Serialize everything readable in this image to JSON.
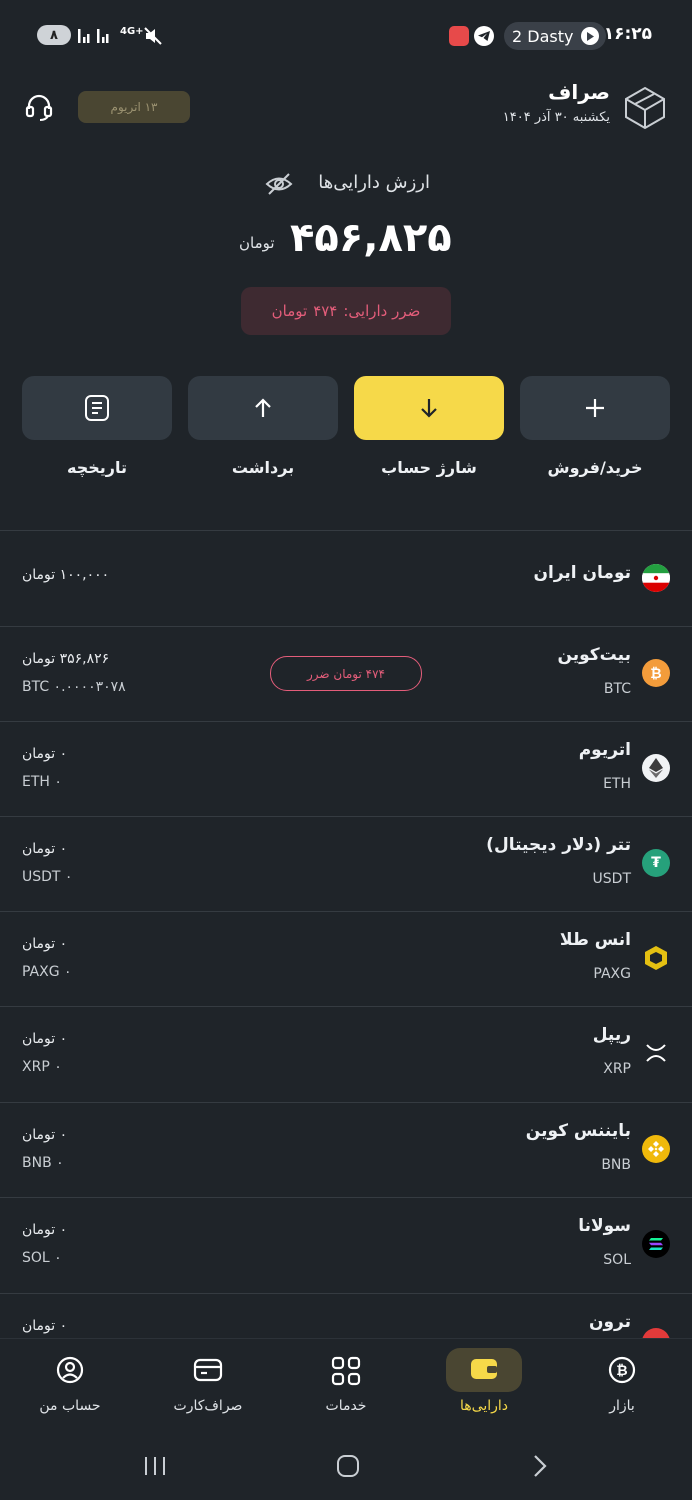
{
  "status_bar": {
    "time": "۱۶:۲۵",
    "media_chip": "2 Dasty",
    "battery": "۸",
    "network": "4G+"
  },
  "header": {
    "app_name": "صراف",
    "date": "یکشنبه ۳۰ آذر ۱۴۰۴",
    "chip": "۱۳ اتریوم"
  },
  "summary": {
    "title": "ارزش دارایی‌ها",
    "total": "۴۵۶,۸۲۵",
    "currency": "تومان",
    "loss_label": "ضرر دارایی:",
    "loss_value": "۴۷۴",
    "loss_currency": "تومان"
  },
  "actions": [
    {
      "label": "خرید/فروش"
    },
    {
      "label": "شارژ حساب"
    },
    {
      "label": "برداشت"
    },
    {
      "label": "تاریخچه"
    }
  ],
  "assets": [
    {
      "name": "تومان ایران",
      "symbol": "",
      "value": "۱۰۰,۰۰۰ تومان",
      "amount": "",
      "badge": ""
    },
    {
      "name": "بیت‌کوین",
      "symbol": "BTC",
      "value": "۳۵۶,۸۲۶ تومان",
      "amount": "BTC ۰.۰۰۰۰۳۰۷۸",
      "badge": "۴۷۴ تومان ضرر"
    },
    {
      "name": "اتریوم",
      "symbol": "ETH",
      "value": "۰ تومان",
      "amount": "ETH ۰",
      "badge": ""
    },
    {
      "name": "تتر (دلار دیجیتال)",
      "symbol": "USDT",
      "value": "۰ تومان",
      "amount": "USDT ۰",
      "badge": ""
    },
    {
      "name": "انس طلا",
      "symbol": "PAXG",
      "value": "۰ تومان",
      "amount": "PAXG ۰",
      "badge": ""
    },
    {
      "name": "ریپل",
      "symbol": "XRP",
      "value": "۰ تومان",
      "amount": "XRP ۰",
      "badge": ""
    },
    {
      "name": "بایننس کوین",
      "symbol": "BNB",
      "value": "۰ تومان",
      "amount": "BNB ۰",
      "badge": ""
    },
    {
      "name": "سولانا",
      "symbol": "SOL",
      "value": "۰ تومان",
      "amount": "SOL ۰",
      "badge": ""
    },
    {
      "name": "ترون",
      "symbol": "",
      "value": "۰ تومان",
      "amount": "",
      "badge": ""
    }
  ],
  "bottom_nav": [
    {
      "label": "بازار",
      "icon": "bitcoin-icon"
    },
    {
      "label": "دارایی‌ها",
      "icon": "wallet-icon"
    },
    {
      "label": "خدمات",
      "icon": "grid-icon"
    },
    {
      "label": "صراف‌کارت",
      "icon": "card-icon"
    },
    {
      "label": "حساب من",
      "icon": "user-icon"
    }
  ],
  "colors": {
    "background": "#1f2429",
    "accent_yellow": "#f6d949",
    "loss_red": "#e35d7a",
    "card": "#323a42"
  }
}
